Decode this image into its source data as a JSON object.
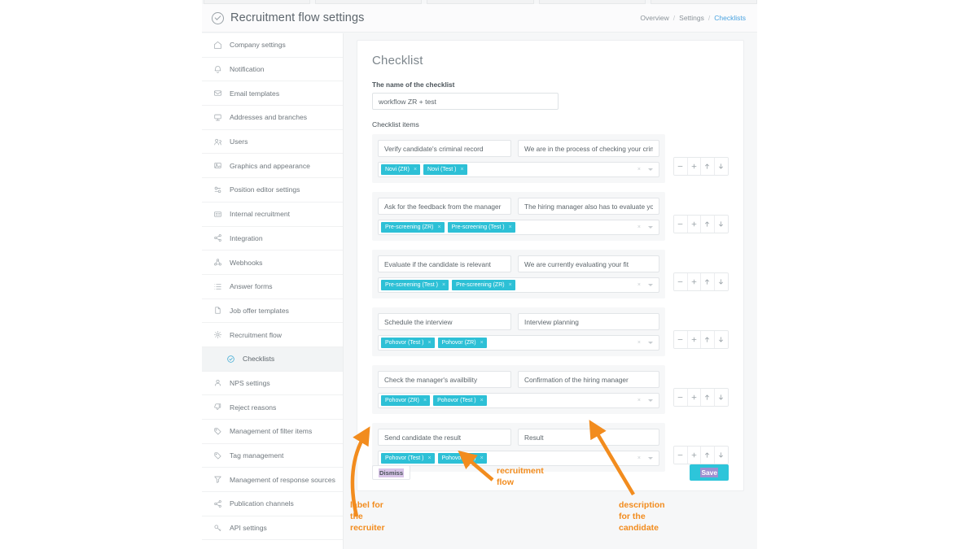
{
  "header": {
    "title": "Recruitment flow settings",
    "check_icon": "circle-check-icon",
    "breadcrumb": [
      {
        "label": "Overview",
        "active": false
      },
      {
        "label": "Settings",
        "active": false
      },
      {
        "label": "Checklists",
        "active": true
      }
    ],
    "breadcrumb_separator": "/"
  },
  "sidebar": {
    "items": [
      {
        "label": "Company settings",
        "icon": "home-icon",
        "active": false,
        "sub": false
      },
      {
        "label": "Notification",
        "icon": "bell-icon",
        "active": false,
        "sub": false
      },
      {
        "label": "Email templates",
        "icon": "envelope-icon",
        "active": false,
        "sub": false
      },
      {
        "label": "Addresses and branches",
        "icon": "building-icon",
        "active": false,
        "sub": false
      },
      {
        "label": "Users",
        "icon": "users-icon",
        "active": false,
        "sub": false
      },
      {
        "label": "Graphics and appearance",
        "icon": "image-icon",
        "active": false,
        "sub": false
      },
      {
        "label": "Position editor settings",
        "icon": "sliders-icon",
        "active": false,
        "sub": false
      },
      {
        "label": "Internal recruitment",
        "icon": "id-card-icon",
        "active": false,
        "sub": false
      },
      {
        "label": "Integration",
        "icon": "share-icon",
        "active": false,
        "sub": false
      },
      {
        "label": "Webhooks",
        "icon": "nodes-icon",
        "active": false,
        "sub": false
      },
      {
        "label": "Answer forms",
        "icon": "list-icon",
        "active": false,
        "sub": false
      },
      {
        "label": "Job offer templates",
        "icon": "file-icon",
        "active": false,
        "sub": false
      },
      {
        "label": "Recruitment flow",
        "icon": "gear-icon",
        "active": false,
        "sub": false
      },
      {
        "label": "Checklists",
        "icon": "circle-check-icon",
        "active": true,
        "sub": true
      },
      {
        "label": "NPS settings",
        "icon": "user-icon",
        "active": false,
        "sub": false
      },
      {
        "label": "Reject reasons",
        "icon": "thumbs-down-icon",
        "active": false,
        "sub": false
      },
      {
        "label": "Management of filter items",
        "icon": "tag-icon",
        "active": false,
        "sub": false
      },
      {
        "label": "Tag management",
        "icon": "tag-outline-icon",
        "active": false,
        "sub": false
      },
      {
        "label": "Management of response sources",
        "icon": "funnel-icon",
        "active": false,
        "sub": false
      },
      {
        "label": "Publication channels",
        "icon": "share-icon",
        "active": false,
        "sub": false
      },
      {
        "label": "API settings",
        "icon": "key-icon",
        "active": false,
        "sub": false
      }
    ]
  },
  "main": {
    "page_title": "Checklist",
    "name_field": {
      "label": "The name of the checklist",
      "value": "workflow ZR + test"
    },
    "items_label": "Checklist items",
    "select_clear_icon": "clear-x-icon",
    "select_caret_icon": "chevron-down-icon",
    "chip_remove_icon": "chip-remove-x-icon",
    "stepper": {
      "decrease": "minus-icon",
      "increase": "plus-icon",
      "move_up": "arrow-up-icon",
      "move_down": "arrow-down-icon"
    },
    "rows": [
      {
        "label": "Verify candidate's criminal record",
        "description": "We are in the process of checking your crin",
        "tags": [
          "Novi (ZR)",
          "Novi (Test )"
        ]
      },
      {
        "label": "Ask for the feedback from the manager",
        "description": "The hiring manager also has to evaluate you",
        "tags": [
          "Pre-screening (ZR)",
          "Pre-screening (Test )"
        ]
      },
      {
        "label": "Evaluate if the candidate is relevant",
        "description": "We are currently evaluating your fit",
        "tags": [
          "Pre-screening (Test )",
          "Pre-screening (ZR)"
        ]
      },
      {
        "label": "Schedule the interview",
        "description": "Interview planning",
        "tags": [
          "Pohovor (Test )",
          "Pohovor (ZR)"
        ]
      },
      {
        "label": "Check the manager's availbility",
        "description": "Confirmation of the hiring manager",
        "tags": [
          "Pohovor (ZR)",
          "Pohovor (Test )"
        ]
      },
      {
        "label": "Send candidate the result",
        "description": "Result",
        "tags": [
          "Pohovor (Test )",
          "Pohovor (ZR)"
        ]
      }
    ],
    "footer": {
      "dismiss_label": "Dismiss",
      "save_label": "Save"
    }
  },
  "annotations": {
    "color": "#f28c1e",
    "items": [
      {
        "id": "recruiter",
        "text": "label for\nthe\nrecruiter"
      },
      {
        "id": "flow",
        "text": "recruitment\nflow"
      },
      {
        "id": "candidate",
        "text": "description\nfor the\ncandidate"
      }
    ]
  },
  "colors": {
    "accent_teal": "#2dc5da",
    "chip_teal": "#2dc0d6",
    "link_blue": "#4aa3e0",
    "annotation_orange": "#f28c1e",
    "selection_purple": "#d8c4e8"
  }
}
